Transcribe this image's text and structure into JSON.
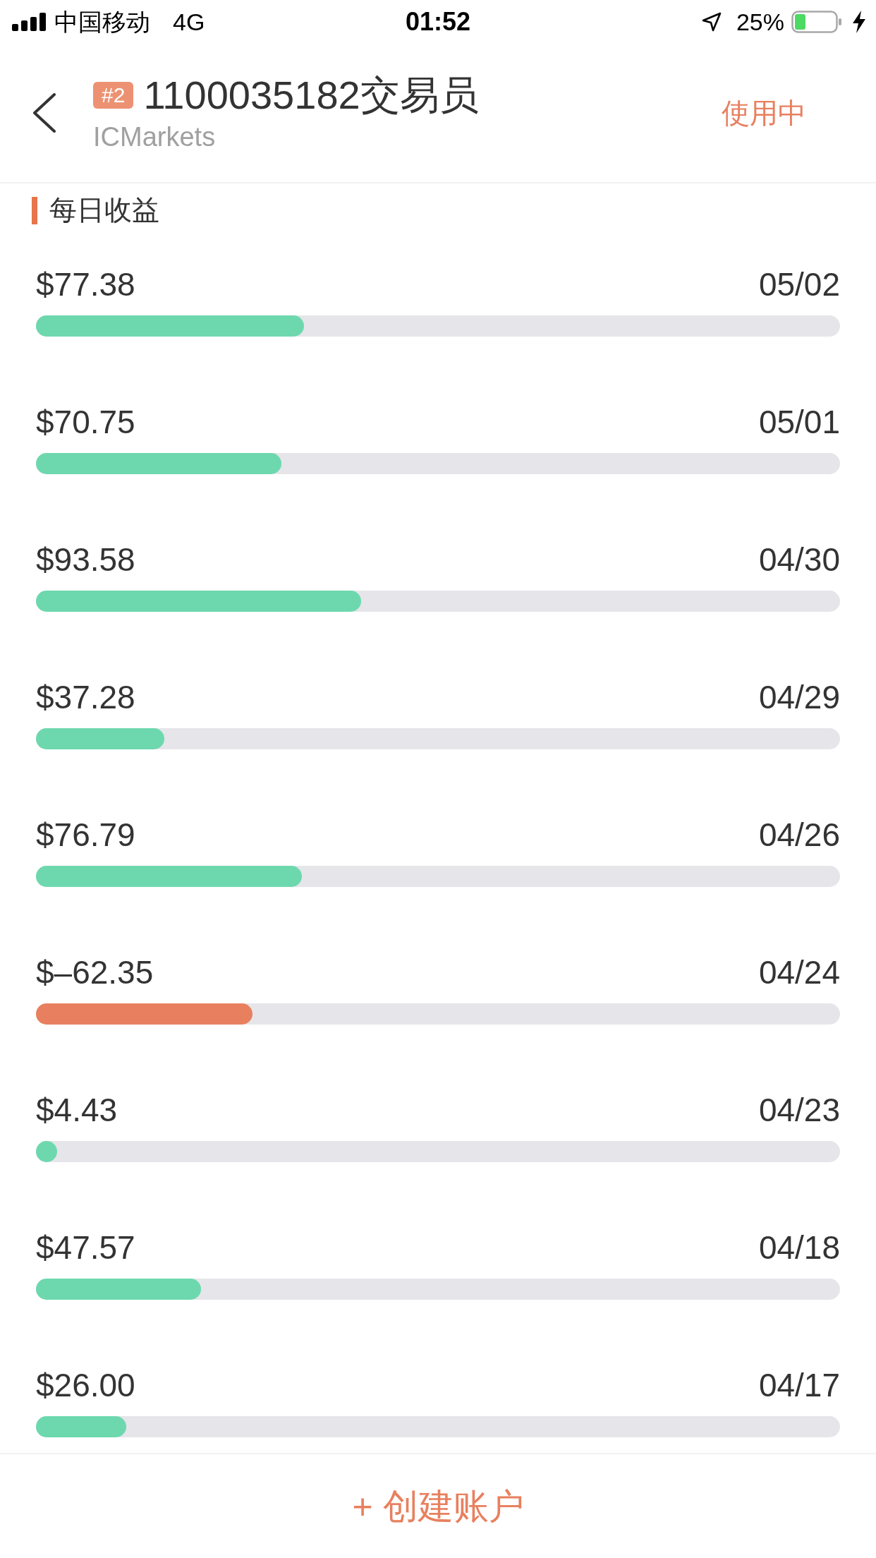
{
  "status_bar": {
    "carrier": "中国移动",
    "network": "4G",
    "time": "01:52",
    "battery": "25%"
  },
  "header": {
    "badge": "#2",
    "title": "1100035182交易员",
    "subtitle": "ICMarkets",
    "status": "使用中"
  },
  "section": {
    "title": "每日收益"
  },
  "earnings": [
    {
      "amount": "$77.38",
      "date": "05/02",
      "level": 0.333,
      "color": "#6dd8ae"
    },
    {
      "amount": "$70.75",
      "date": "05/01",
      "level": 0.305,
      "color": "#6dd8ae"
    },
    {
      "amount": "$93.58",
      "date": "04/30",
      "level": 0.404,
      "color": "#6dd8ae"
    },
    {
      "amount": "$37.28",
      "date": "04/29",
      "level": 0.16,
      "color": "#6dd8ae"
    },
    {
      "amount": "$76.79",
      "date": "04/26",
      "level": 0.331,
      "color": "#6dd8ae"
    },
    {
      "amount": "$–62.35",
      "date": "04/24",
      "level": 0.269,
      "color": "#e8805f"
    },
    {
      "amount": "$4.43",
      "date": "04/23",
      "level": 0.026,
      "color": "#6dd8ae"
    },
    {
      "amount": "$47.57",
      "date": "04/18",
      "level": 0.205,
      "color": "#6dd8ae"
    },
    {
      "amount": "$26.00",
      "date": "04/17",
      "level": 0.112,
      "color": "#6dd8ae"
    }
  ],
  "footer": {
    "button": "+ 创建账户"
  }
}
